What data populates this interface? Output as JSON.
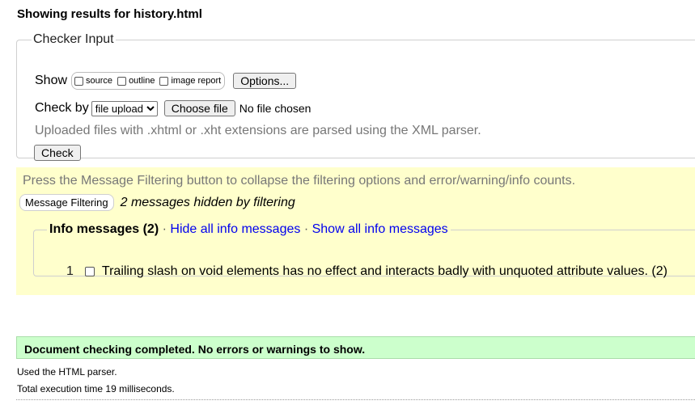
{
  "title": "Showing results for history.html",
  "checker": {
    "legend": "Checker Input",
    "show_label": "Show",
    "options": [
      "source",
      "outline",
      "image report"
    ],
    "options_button": "Options...",
    "check_by_label": "Check by",
    "check_by_value": "file upload",
    "choose_file": "Choose file",
    "no_file": "No file chosen",
    "hint": "Uploaded files with .xhtml or .xht extensions are parsed using the XML parser.",
    "check_button": "Check"
  },
  "filtering": {
    "hint": "Press the Message Filtering button to collapse the filtering options and error/warning/info counts.",
    "button": "Message Filtering",
    "hidden_note": "2 messages hidden by filtering",
    "info_legend": "Info messages (2)",
    "sep": "·",
    "hide_all": "Hide all info messages",
    "show_all": "Show all info messages",
    "messages": [
      {
        "num": "1",
        "text": "Trailing slash on void elements has no effect and interacts badly with unquoted attribute values. (2)"
      }
    ]
  },
  "result": {
    "done": "Document checking completed. No errors or warnings to show.",
    "parser": "Used the HTML parser.",
    "time": "Total execution time 19 milliseconds."
  }
}
